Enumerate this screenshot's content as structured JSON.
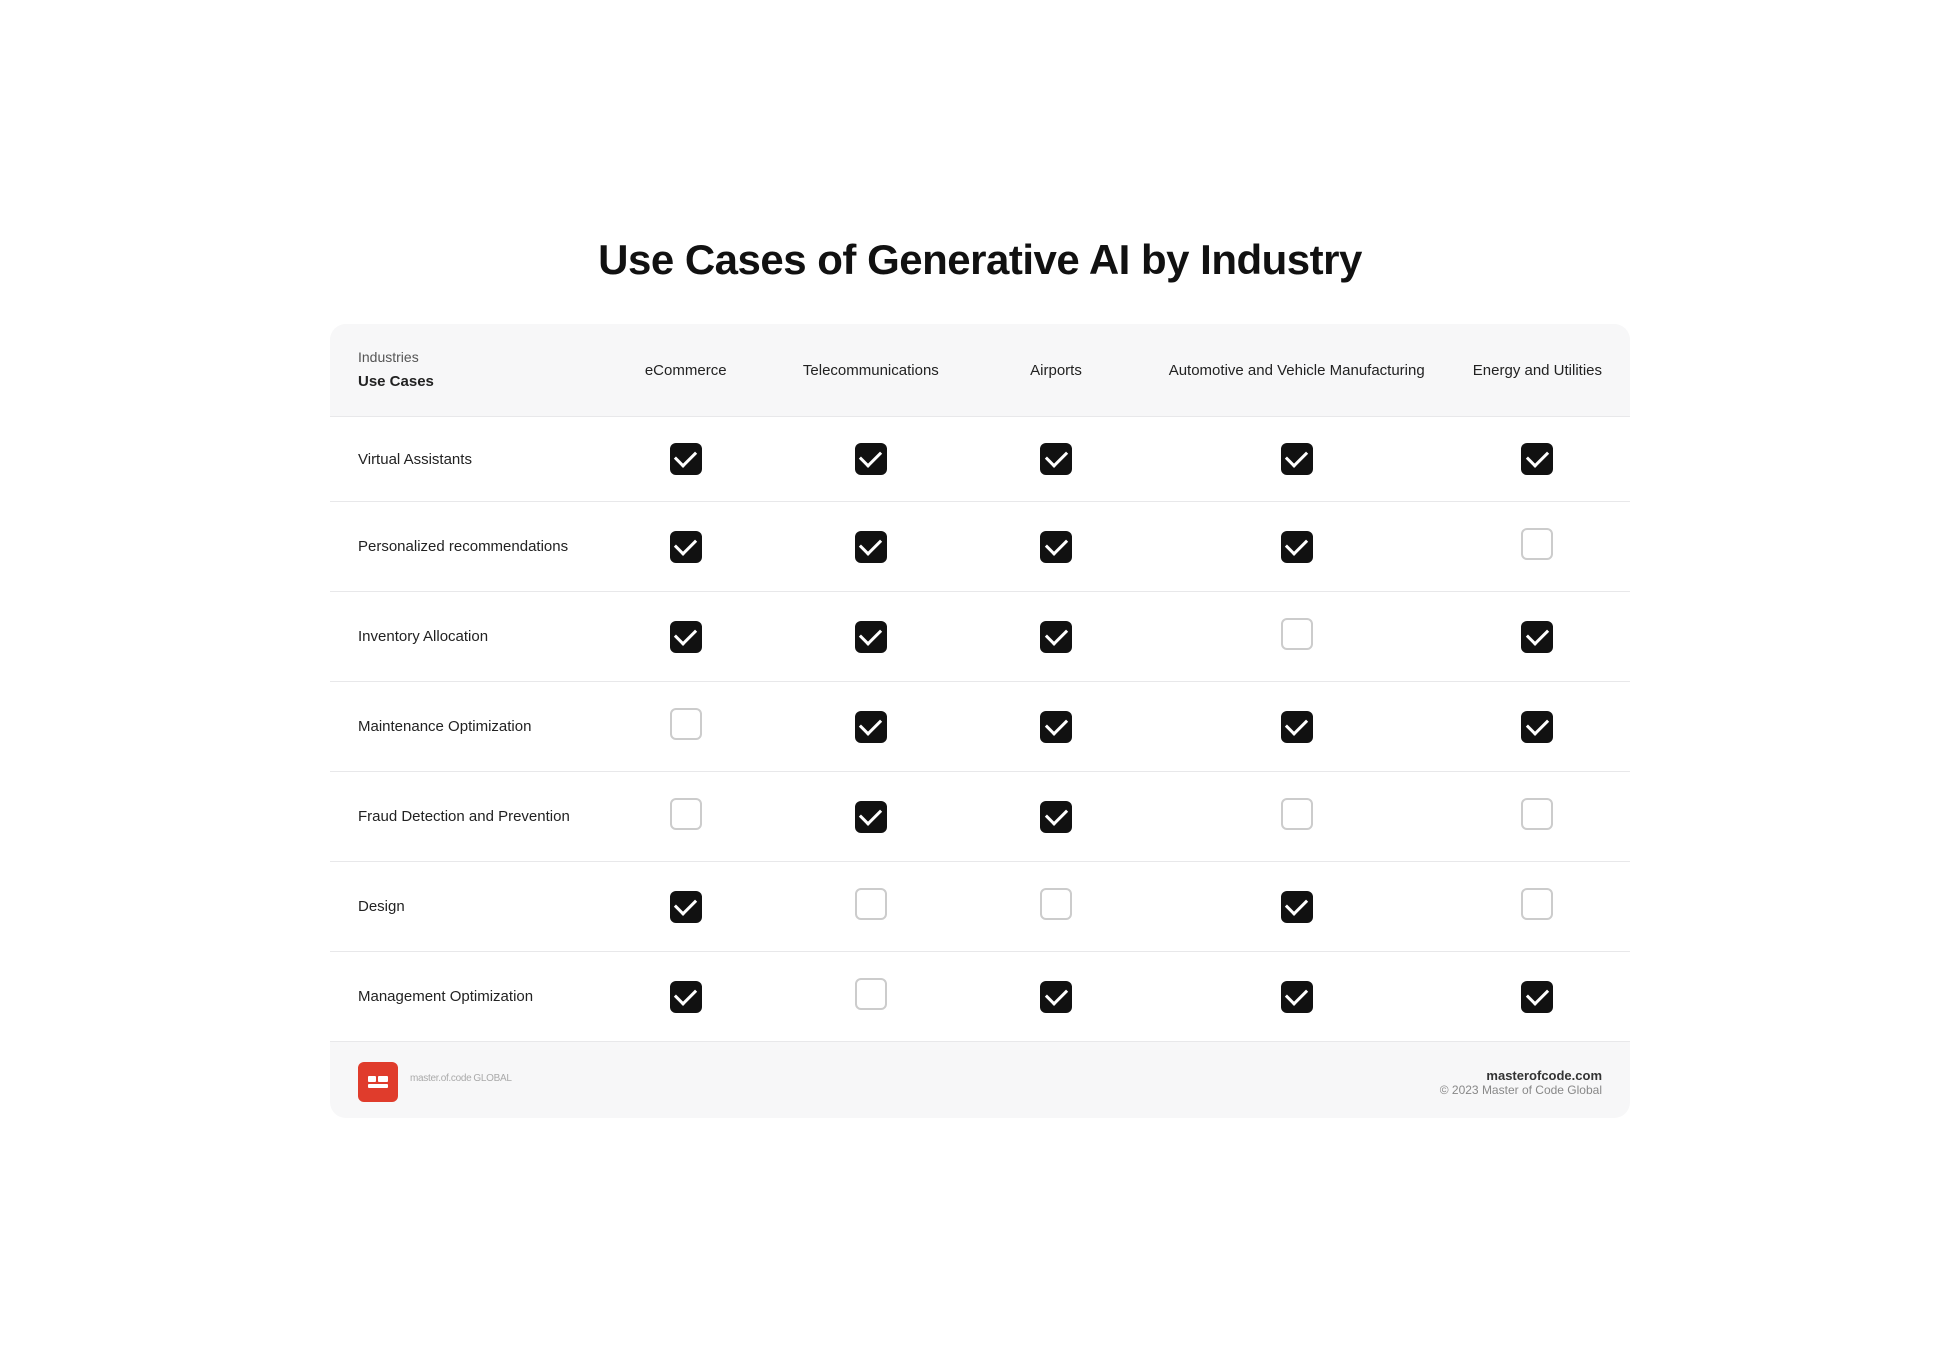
{
  "page": {
    "title": "Use Cases of Generative AI by Industry"
  },
  "table": {
    "header": {
      "industries_label": "Industries",
      "use_cases_label": "Use Cases",
      "columns": [
        {
          "id": "ecommerce",
          "label": "eCommerce"
        },
        {
          "id": "telecom",
          "label": "Telecommunications"
        },
        {
          "id": "airports",
          "label": "Airports"
        },
        {
          "id": "automotive",
          "label": "Automotive and Vehicle Manufacturing"
        },
        {
          "id": "energy",
          "label": "Energy and Utilities"
        }
      ]
    },
    "rows": [
      {
        "label": "Virtual Assistants",
        "values": [
          true,
          true,
          true,
          true,
          true
        ]
      },
      {
        "label": "Personalized recommendations",
        "values": [
          true,
          true,
          true,
          true,
          false
        ]
      },
      {
        "label": "Inventory Allocation",
        "values": [
          true,
          true,
          true,
          false,
          true
        ]
      },
      {
        "label": "Maintenance Optimization",
        "values": [
          false,
          true,
          true,
          true,
          true
        ]
      },
      {
        "label": "Fraud Detection and Prevention",
        "values": [
          false,
          true,
          true,
          false,
          false
        ]
      },
      {
        "label": "Design",
        "values": [
          true,
          false,
          false,
          true,
          false
        ]
      },
      {
        "label": "Management Optimization",
        "values": [
          true,
          false,
          true,
          true,
          true
        ]
      }
    ]
  },
  "footer": {
    "logo_text": "master.of.code",
    "logo_suffix": "GLOBAL",
    "site_url": "masterofcode.com",
    "copyright": "© 2023 Master of Code Global"
  }
}
